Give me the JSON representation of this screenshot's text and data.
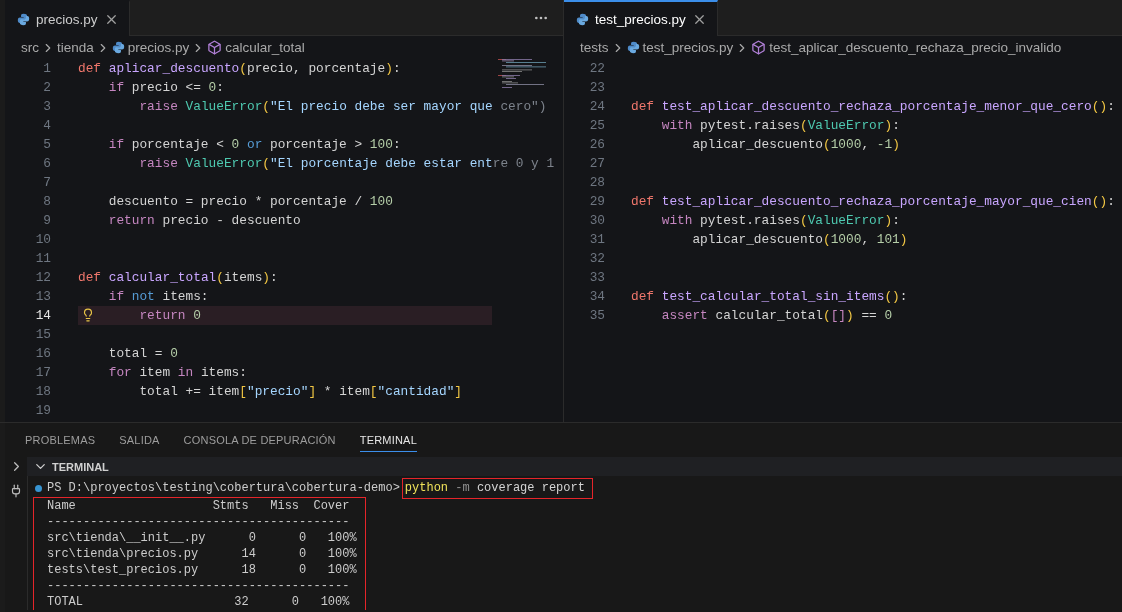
{
  "editors": [
    {
      "tab": {
        "label": "precios.py",
        "focused": false
      },
      "minimap": true,
      "breadcrumb": [
        {
          "kind": "folder",
          "label": "src"
        },
        {
          "kind": "folder",
          "label": "tienda"
        },
        {
          "kind": "file",
          "label": "precios.py"
        },
        {
          "kind": "symbol",
          "label": "calcular_total"
        }
      ],
      "lines": [
        {
          "number": "1",
          "tokens": [
            {
              "kind": "def",
              "text": "def"
            },
            {
              "kind": "fn",
              "text": " aplicar_descuento"
            },
            {
              "kind": "paren",
              "text": "("
            },
            {
              "kind": "plain",
              "text": "precio, porcentaje"
            },
            {
              "kind": "paren",
              "text": ")"
            },
            {
              "kind": "plain",
              "text": ":"
            }
          ]
        },
        {
          "number": "2",
          "tokens": [
            {
              "kind": "control",
              "text": "    if"
            },
            {
              "kind": "plain",
              "text": " precio <= "
            },
            {
              "kind": "num",
              "text": "0"
            },
            {
              "kind": "plain",
              "text": ":"
            }
          ]
        },
        {
          "number": "3",
          "tokens": [
            {
              "kind": "control",
              "text": "        raise"
            },
            {
              "kind": "cls",
              "text": " ValueError"
            },
            {
              "kind": "paren",
              "text": "("
            },
            {
              "kind": "str",
              "text": "\"El precio debe ser mayor que"
            },
            {
              "kind": "faded",
              "text": " cero\")"
            }
          ]
        },
        {
          "number": "4"
        },
        {
          "number": "5",
          "tokens": [
            {
              "kind": "control",
              "text": "    if"
            },
            {
              "kind": "plain",
              "text": " porcentaje < "
            },
            {
              "kind": "num",
              "text": "0"
            },
            {
              "kind": "logic",
              "text": " or"
            },
            {
              "kind": "plain",
              "text": " porcentaje > "
            },
            {
              "kind": "num",
              "text": "100"
            },
            {
              "kind": "plain",
              "text": ":"
            }
          ]
        },
        {
          "number": "6",
          "tokens": [
            {
              "kind": "control",
              "text": "        raise"
            },
            {
              "kind": "cls",
              "text": " ValueError"
            },
            {
              "kind": "paren",
              "text": "("
            },
            {
              "kind": "str",
              "text": "\"El porcentaje debe estar ent"
            },
            {
              "kind": "faded",
              "text": "re 0 y 1"
            }
          ]
        },
        {
          "number": "7"
        },
        {
          "number": "8",
          "tokens": [
            {
              "kind": "plain",
              "text": "    descuento = precio * porcentaje / "
            },
            {
              "kind": "num",
              "text": "100"
            }
          ]
        },
        {
          "number": "9",
          "tokens": [
            {
              "kind": "control",
              "text": "    return"
            },
            {
              "kind": "plain",
              "text": " precio - descuento"
            }
          ]
        },
        {
          "number": "10"
        },
        {
          "number": "11"
        },
        {
          "number": "12",
          "tokens": [
            {
              "kind": "def",
              "text": "def"
            },
            {
              "kind": "fn",
              "text": " calcular_total"
            },
            {
              "kind": "paren",
              "text": "("
            },
            {
              "kind": "plain",
              "text": "items"
            },
            {
              "kind": "paren",
              "text": ")"
            },
            {
              "kind": "plain",
              "text": ":"
            }
          ]
        },
        {
          "number": "13",
          "tokens": [
            {
              "kind": "control",
              "text": "    if"
            },
            {
              "kind": "logic",
              "text": " not"
            },
            {
              "kind": "plain",
              "text": " items:"
            }
          ]
        },
        {
          "number": "14",
          "current": true,
          "lightbulb": true,
          "tokens": [
            {
              "kind": "control",
              "text": "        return"
            },
            {
              "kind": "num",
              "text": " 0"
            }
          ]
        },
        {
          "number": "15"
        },
        {
          "number": "16",
          "tokens": [
            {
              "kind": "plain",
              "text": "    total = "
            },
            {
              "kind": "num",
              "text": "0"
            }
          ]
        },
        {
          "number": "17",
          "tokens": [
            {
              "kind": "control",
              "text": "    for"
            },
            {
              "kind": "plain",
              "text": " item "
            },
            {
              "kind": "control",
              "text": "in"
            },
            {
              "kind": "plain",
              "text": " items:"
            }
          ]
        },
        {
          "number": "18",
          "tokens": [
            {
              "kind": "plain",
              "text": "        total += item"
            },
            {
              "kind": "paren",
              "text": "["
            },
            {
              "kind": "str",
              "text": "\"precio\""
            },
            {
              "kind": "paren",
              "text": "]"
            },
            {
              "kind": "plain",
              "text": " * item"
            },
            {
              "kind": "paren",
              "text": "["
            },
            {
              "kind": "str",
              "text": "\"cantidad\""
            },
            {
              "kind": "paren",
              "text": "]"
            }
          ]
        },
        {
          "number": "19"
        }
      ]
    },
    {
      "tab": {
        "label": "test_precios.py",
        "focused": true
      },
      "breadcrumb": [
        {
          "kind": "folder",
          "label": "tests"
        },
        {
          "kind": "file",
          "label": "test_precios.py"
        },
        {
          "kind": "symbol",
          "label": "test_aplicar_descuento_rechaza_precio_invalido"
        }
      ],
      "lines": [
        {
          "number": "22"
        },
        {
          "number": "23"
        },
        {
          "number": "24",
          "tokens": [
            {
              "kind": "def",
              "text": "def"
            },
            {
              "kind": "fn",
              "text": " test_aplicar_descuento_rechaza_porcentaje_menor_que_cero"
            },
            {
              "kind": "paren",
              "text": "()"
            },
            {
              "kind": "plain",
              "text": ":"
            }
          ]
        },
        {
          "number": "25",
          "tokens": [
            {
              "kind": "control",
              "text": "    with"
            },
            {
              "kind": "plain",
              "text": " pytest.raises"
            },
            {
              "kind": "paren",
              "text": "("
            },
            {
              "kind": "cls",
              "text": "ValueError"
            },
            {
              "kind": "paren",
              "text": ")"
            },
            {
              "kind": "plain",
              "text": ":"
            }
          ]
        },
        {
          "number": "26",
          "tokens": [
            {
              "kind": "plain",
              "text": "        aplicar_descuento"
            },
            {
              "kind": "paren",
              "text": "("
            },
            {
              "kind": "num",
              "text": "1000"
            },
            {
              "kind": "plain",
              "text": ", "
            },
            {
              "kind": "num",
              "text": "-1"
            },
            {
              "kind": "paren",
              "text": ")"
            }
          ]
        },
        {
          "number": "27"
        },
        {
          "number": "28"
        },
        {
          "number": "29",
          "tokens": [
            {
              "kind": "def",
              "text": "def"
            },
            {
              "kind": "fn",
              "text": " test_aplicar_descuento_rechaza_porcentaje_mayor_que_cien"
            },
            {
              "kind": "paren",
              "text": "()"
            },
            {
              "kind": "plain",
              "text": ":"
            }
          ]
        },
        {
          "number": "30",
          "tokens": [
            {
              "kind": "control",
              "text": "    with"
            },
            {
              "kind": "plain",
              "text": " pytest.raises"
            },
            {
              "kind": "paren",
              "text": "("
            },
            {
              "kind": "cls",
              "text": "ValueError"
            },
            {
              "kind": "paren",
              "text": ")"
            },
            {
              "kind": "plain",
              "text": ":"
            }
          ]
        },
        {
          "number": "31",
          "tokens": [
            {
              "kind": "plain",
              "text": "        aplicar_descuento"
            },
            {
              "kind": "paren",
              "text": "("
            },
            {
              "kind": "num",
              "text": "1000"
            },
            {
              "kind": "plain",
              "text": ", "
            },
            {
              "kind": "num",
              "text": "101"
            },
            {
              "kind": "paren",
              "text": ")"
            }
          ]
        },
        {
          "number": "32"
        },
        {
          "number": "33"
        },
        {
          "number": "34",
          "tokens": [
            {
              "kind": "def",
              "text": "def"
            },
            {
              "kind": "fn",
              "text": " test_calcular_total_sin_items"
            },
            {
              "kind": "paren",
              "text": "()"
            },
            {
              "kind": "plain",
              "text": ":"
            }
          ]
        },
        {
          "number": "35",
          "tokens": [
            {
              "kind": "control",
              "text": "    assert"
            },
            {
              "kind": "plain",
              "text": " calcular_total"
            },
            {
              "kind": "paren",
              "text": "("
            },
            {
              "kind": "bracket",
              "text": "[]"
            },
            {
              "kind": "paren",
              "text": ")"
            },
            {
              "kind": "plain",
              "text": " == "
            },
            {
              "kind": "num",
              "text": "0"
            }
          ]
        }
      ]
    }
  ],
  "panel": {
    "tabs": [
      {
        "label": "PROBLEMAS",
        "selected": false
      },
      {
        "label": "SALIDA",
        "selected": false
      },
      {
        "label": "CONSOLA DE DEPURACIÓN",
        "selected": false
      },
      {
        "label": "TERMINAL",
        "selected": true
      }
    ],
    "section_title": "TERMINAL",
    "prompt": "PS D:\\proyectos\\testing\\cobertura\\cobertura-demo>",
    "command": {
      "highlighted": true,
      "tokens": [
        {
          "kind": "exe",
          "text": "python"
        },
        {
          "kind": "flag",
          "text": " -m"
        },
        {
          "kind": "plain",
          "text": " coverage report"
        }
      ]
    },
    "output": {
      "highlighted": true,
      "lines": [
        "Name                   Stmts   Miss  Cover",
        "------------------------------------------",
        "src\\tienda\\__init__.py      0      0   100%",
        "src\\tienda\\precios.py      14      0   100%",
        "tests\\test_precios.py      18      0   100%",
        "------------------------------------------",
        "TOTAL                     32      0   100%"
      ]
    }
  }
}
